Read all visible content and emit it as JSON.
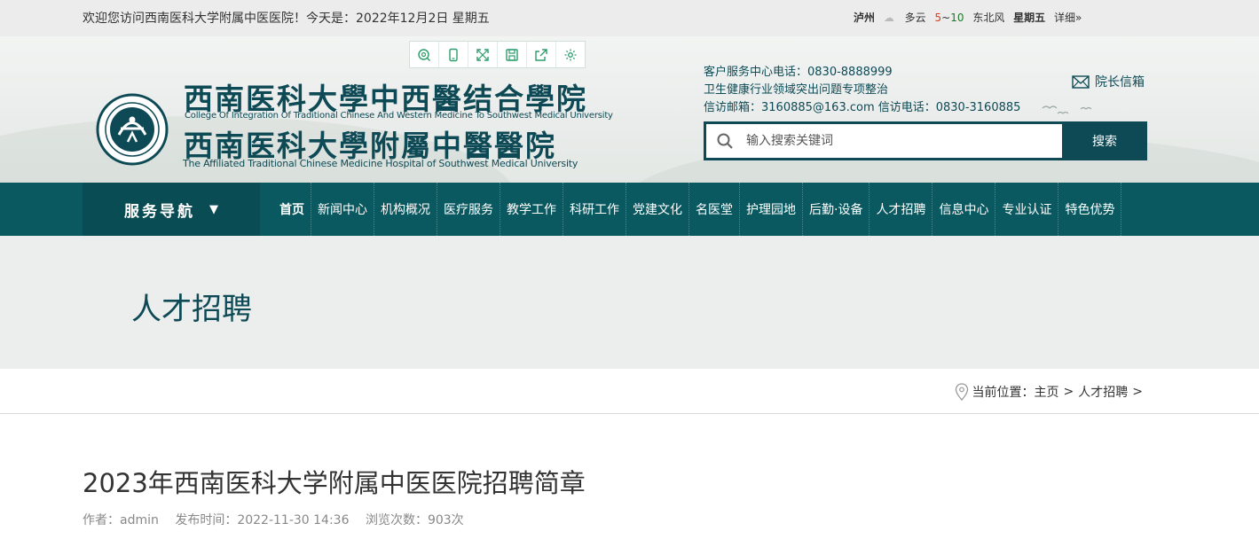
{
  "topbar": {
    "welcome": "欢迎您访问西南医科大学附属中医医院！今天是：2022年12月2日 星期五",
    "weather": {
      "city": "泸州",
      "condition": "多云",
      "temp_low": "5",
      "temp_sep": "~",
      "temp_high": "10",
      "wind": "东北风",
      "weekday": "星期五",
      "detail": "详细»"
    }
  },
  "header": {
    "logo": {
      "cn_line1": "西南医科大學中西醫结合學院",
      "en_line1": "College Of Integration Of Traditional Chinese And Western Medicine To Southwest Medical University",
      "cn_line2": "西南医科大學附屬中醫醫院",
      "en_line2": "The Affiliated Traditional Chinese Medicine Hospital of Southwest Medical University"
    },
    "contact": {
      "line1": "客户服务中心电话：0830-8888999",
      "line2": "卫生健康行业领域突出问题专项整治",
      "line3": "信访邮箱：3160885@163.com 信访电话：0830-3160885"
    },
    "mailbox": "院长信箱",
    "search": {
      "placeholder": "输入搜索关键词",
      "button": "搜索"
    }
  },
  "nav": {
    "service": "服务导航",
    "arrow": "▼",
    "items": [
      {
        "label": "首页"
      },
      {
        "label": "新闻中心"
      },
      {
        "label": "机构概况"
      },
      {
        "label": "医疗服务"
      },
      {
        "label": "教学工作"
      },
      {
        "label": "科研工作"
      },
      {
        "label": "党建文化"
      },
      {
        "label": "名医堂"
      },
      {
        "label": "护理园地"
      },
      {
        "label": "后勤·设备"
      },
      {
        "label": "人才招聘"
      },
      {
        "label": "信息中心"
      },
      {
        "label": "专业认证"
      },
      {
        "label": "特色优势"
      }
    ]
  },
  "banner": {
    "title": "人才招聘"
  },
  "breadcrumb": {
    "prefix": "当前位置：",
    "items": [
      "主页",
      "人才招聘"
    ],
    "sep": ">"
  },
  "article": {
    "title": "2023年西南医科大学附属中医医院招聘简章",
    "author": "作者：admin",
    "published": "发布时间：2022-11-30 14:36",
    "views": "浏览次数：903次"
  },
  "colors": {
    "brand": "#0d4a55",
    "nav_bg": "#0b5960",
    "temp_low": "#e03a1b",
    "temp_high": "#1d7a2c"
  },
  "icons": [
    "search-icon",
    "mail-icon",
    "location-pin-icon",
    "zoom-icon",
    "mobile-icon",
    "fullscreen-icon",
    "save-icon",
    "share-icon",
    "settings-icon"
  ]
}
